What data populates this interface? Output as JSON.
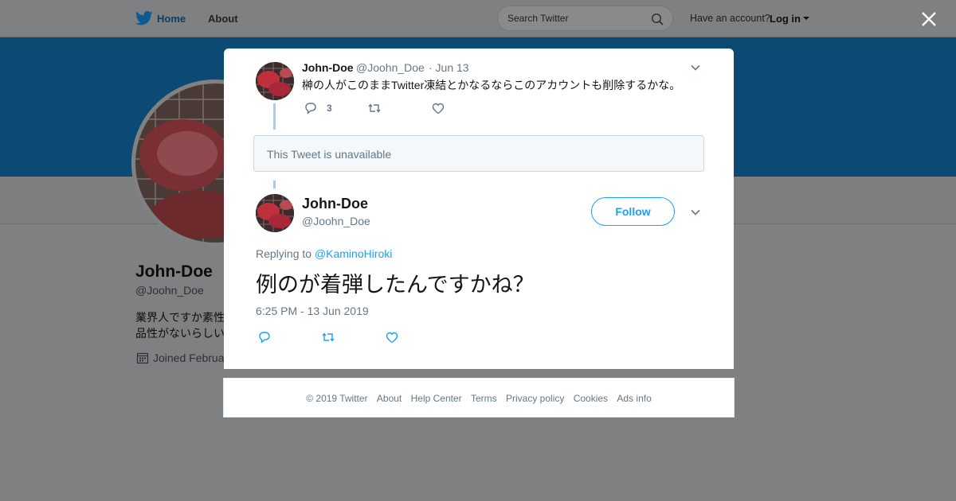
{
  "colors": {
    "accent": "#1da1f2",
    "banner": "#0d4a73",
    "overlay": "#7f8082",
    "thread_line": "#9ecff2"
  },
  "topbar": {
    "logo_icon": "twitter-bird-icon",
    "home_label": "Home",
    "about_label": "About",
    "search_placeholder": "Search Twitter",
    "have_account": "Have an account?",
    "login_label": "Log in"
  },
  "profile": {
    "name": "John-Doe",
    "handle": "@Joohn_Doe",
    "bio_line1": "業界人ですか素性",
    "bio_line2": "品性がないらしい",
    "joined": "Joined Februa"
  },
  "modal": {
    "parent_tweet": {
      "name": "John-Doe",
      "handle": "@Joohn_Doe",
      "date": "· Jun 13",
      "text": "榊の人がこのままTwitter凍結とかなるならこのアカウントも削除するかな。",
      "reply_count": "3"
    },
    "unavailable_text": "This Tweet is unavailable",
    "main_tweet": {
      "name": "John-Doe",
      "handle": "@Joohn_Doe",
      "follow_label": "Follow",
      "replying_to_label": "Replying to",
      "replying_to_handle": "@KaminoHiroki",
      "text": "例のが着弾したんですかね？",
      "timestamp": "6:25 PM - 13 Jun 2019"
    }
  },
  "footer": {
    "links": [
      "© 2019 Twitter",
      "About",
      "Help Center",
      "Terms",
      "Privacy policy",
      "Cookies",
      "Ads info"
    ]
  }
}
